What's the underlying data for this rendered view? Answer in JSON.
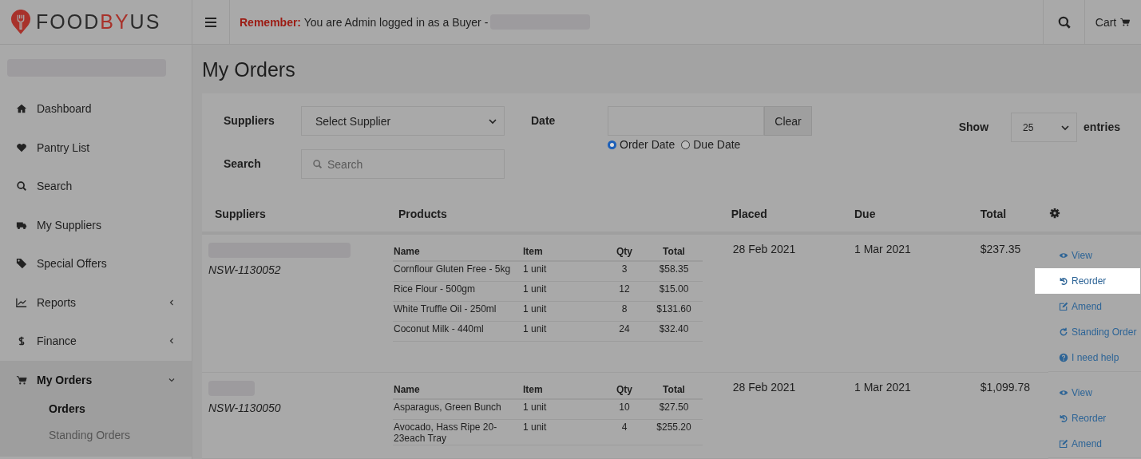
{
  "header": {
    "logo_parts": [
      {
        "text": "FOOD",
        "color": "#2b2b2b"
      },
      {
        "text": "BY",
        "color": "#a8322b"
      },
      {
        "text": "US",
        "color": "#2b2b2b"
      }
    ],
    "notice_label": "Remember:",
    "notice_text": "You are Admin logged in as a Buyer -",
    "cart": "Cart"
  },
  "sidebar": {
    "items": [
      {
        "label": "Dashboard",
        "kind": "home",
        "selected": false
      },
      {
        "label": "Pantry List",
        "kind": "heart",
        "selected": false
      },
      {
        "label": "Search",
        "kind": "search",
        "selected": false
      },
      {
        "label": "My Suppliers",
        "kind": "truck",
        "selected": false
      },
      {
        "label": "Special Offers",
        "kind": "tag",
        "selected": false
      },
      {
        "label": "Reports",
        "kind": "chart",
        "selected": false,
        "expanded": false
      },
      {
        "label": "Finance",
        "kind": "dollar",
        "selected": false,
        "expanded": false
      },
      {
        "label": "My Orders",
        "kind": "cart",
        "selected": true,
        "expanded": true,
        "children": [
          {
            "label": "Orders",
            "selected": true
          },
          {
            "label": "Standing Orders",
            "selected": false
          }
        ]
      }
    ]
  },
  "page_title": "My Orders",
  "filters": {
    "suppliers_label": "Suppliers",
    "supplier_select": "Select Supplier",
    "date_label": "Date",
    "clear_button": "Clear",
    "date_types": [
      {
        "label": "Order Date",
        "selected": true
      },
      {
        "label": "Due Date",
        "selected": false
      }
    ],
    "search_label": "Search",
    "search_placeholder": "Search",
    "show_label": "Show",
    "show_value": "25",
    "entries_label": "entries"
  },
  "table": {
    "columns": [
      "Suppliers",
      "Products",
      "Placed",
      "Due",
      "Total"
    ],
    "rows": [
      {
        "order_no": "NSW-1130052",
        "product_columns": [
          "Name",
          "Item",
          "Qty",
          "Total"
        ],
        "products": [
          {
            "name": "Cornflour Gluten Free - 5kg",
            "item": "1 unit",
            "qty": "3",
            "total": "$58.35"
          },
          {
            "name": "Rice Flour - 500gm",
            "item": "1 unit",
            "qty": "12",
            "total": "$15.00"
          },
          {
            "name": "White Truffle Oil - 250ml",
            "item": "1 unit",
            "qty": "8",
            "total": "$131.60"
          },
          {
            "name": "Coconut Milk - 440ml",
            "item": "1 unit",
            "qty": "24",
            "total": "$32.40"
          }
        ],
        "placed": "28 Feb 2021",
        "due": "1 Mar 2021",
        "total": "$237.35",
        "actions": [
          {
            "label": "View",
            "kind": "view",
            "highlighted": false
          },
          {
            "label": "Reorder",
            "kind": "reorder",
            "highlighted": true
          },
          {
            "label": "Amend",
            "kind": "amend",
            "highlighted": false
          },
          {
            "label": "Standing Order",
            "kind": "standing",
            "highlighted": false
          },
          {
            "label": "I need help",
            "kind": "help",
            "highlighted": false
          }
        ]
      },
      {
        "order_no": "NSW-1130050",
        "product_columns": [
          "Name",
          "Item",
          "Qty",
          "Total"
        ],
        "products": [
          {
            "name": "Asparagus, Green Bunch",
            "item": "1 unit",
            "qty": "10",
            "total": "$27.50"
          },
          {
            "name": "Avocado, Hass Ripe 20-23each Tray",
            "item": "1 unit",
            "qty": "4",
            "total": "$255.20"
          }
        ],
        "placed": "28 Feb 2021",
        "due": "1 Mar 2021",
        "total": "$1,099.78",
        "actions": [
          {
            "label": "View",
            "kind": "view",
            "highlighted": false
          },
          {
            "label": "Reorder",
            "kind": "reorder",
            "highlighted": false
          },
          {
            "label": "Amend",
            "kind": "amend",
            "highlighted": false
          }
        ]
      }
    ]
  }
}
